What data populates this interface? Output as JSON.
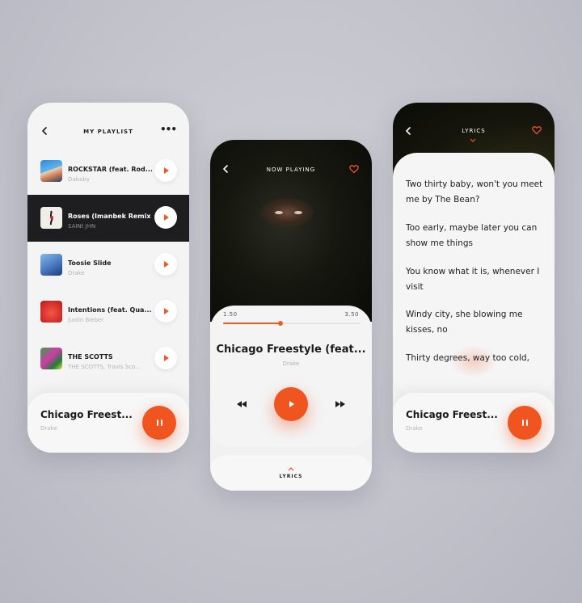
{
  "playlist": {
    "title": "MY PLAYLIST",
    "more": "•••",
    "tracks": [
      {
        "title": "ROCKSTAR (feat. Rod...",
        "artist": "Dababy"
      },
      {
        "title": "Roses (Imanbek Remix",
        "artist": "SAINt JHN"
      },
      {
        "title": "Toosie Slide",
        "artist": "Drake"
      },
      {
        "title": "Intentions (feat. Qua...",
        "artist": "Justin Bieber"
      },
      {
        "title": "THE SCOTTS",
        "artist": "THE SCOTTS, Travis Sco..."
      }
    ],
    "mini_player": {
      "title": "Chicago Freest...",
      "artist": "Drake"
    }
  },
  "now_playing": {
    "title": "NOW PLAYING",
    "elapsed": "1.50",
    "duration": "3.50",
    "progress": 0.42,
    "song_title": "Chicago Freestyle (feat...",
    "song_artist": "Drake",
    "lyrics_tab": "LYRICS"
  },
  "lyrics": {
    "title": "LYRICS",
    "lines": [
      "Two thirty baby, won't you meet me by The Bean?",
      "Too early, maybe later you can show me things",
      "You know what it is, whenever I visit",
      "Windy city, she blowing me kisses, no",
      "Thirty degrees, way too cold,"
    ],
    "mini_player": {
      "title": "Chicago Freest...",
      "artist": "Drake"
    }
  },
  "colors": {
    "accent": "#f0541f",
    "dark": "#1e1e20",
    "background": "#c5c6cd"
  },
  "icons": {
    "back": "back-chevron-icon",
    "more": "more-dots-icon",
    "play": "play-icon",
    "pause": "pause-icon",
    "heart": "heart-icon",
    "rewind": "rewind-icon",
    "forward": "fast-forward-icon"
  }
}
